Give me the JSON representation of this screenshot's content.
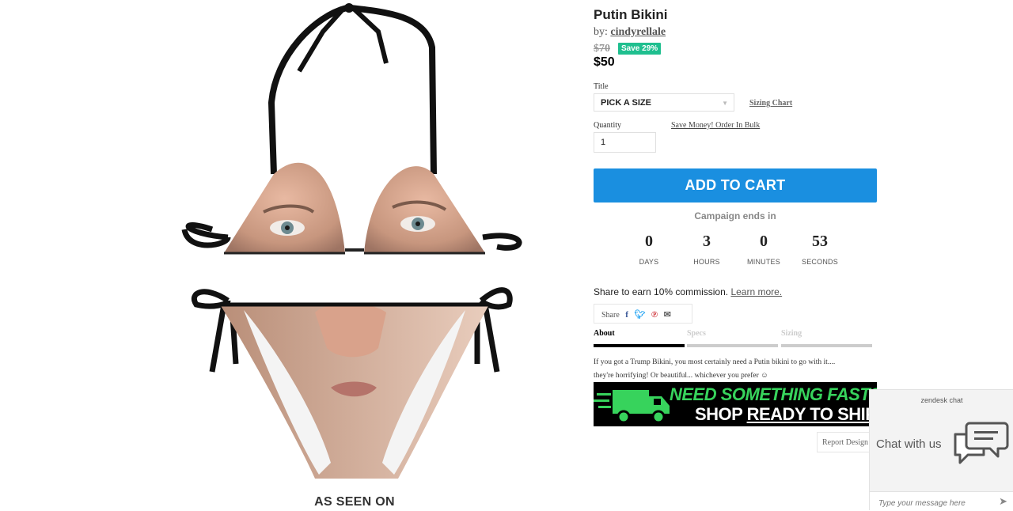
{
  "product": {
    "title": "Putin Bikini",
    "by_label": "by:",
    "creator": "cindyrellale",
    "old_price": "$70",
    "save_badge": "Save 29%",
    "price": "$50",
    "section_bottom": "AS SEEN ON"
  },
  "options": {
    "title_label": "Title",
    "size_value": "PICK A SIZE",
    "sizing_chart_link": "Sizing Chart",
    "quantity_label": "Quantity",
    "bulk_link": "Save Money! Order In Bulk",
    "quantity_value": "1"
  },
  "cart": {
    "button_label": "ADD TO CART"
  },
  "campaign": {
    "ends_label": "Campaign ends in",
    "countdown": [
      {
        "value": "0",
        "unit": "DAYS"
      },
      {
        "value": "3",
        "unit": "HOURS"
      },
      {
        "value": "0",
        "unit": "MINUTES"
      },
      {
        "value": "53",
        "unit": "SECONDS"
      }
    ]
  },
  "share": {
    "earn_text": "Share to earn 10% commission.",
    "learn_more": "Learn more.",
    "share_label": "Share",
    "icons": [
      "facebook-icon",
      "twitter-icon",
      "pinterest-icon",
      "email-icon"
    ]
  },
  "tabs": [
    {
      "label": "About",
      "active": true
    },
    {
      "label": "Specs",
      "active": false
    },
    {
      "label": "Sizing",
      "active": false
    }
  ],
  "about": {
    "line1": "If you got a Trump Bikini, you most certainly need a Putin bikini to go with it....",
    "line2": "they're horrifying! Or beautiful... whichever you prefer ☺"
  },
  "banner": {
    "line1": "NEED SOMETHING FAST?",
    "line2_a": "SHOP",
    "line2_b": "READY TO SHIP."
  },
  "report": {
    "label": "Report Design"
  },
  "chat": {
    "brand": "zendesk chat",
    "cta": "Chat with us",
    "placeholder": "Type your message here"
  },
  "colors": {
    "accent_blue": "#1a8fe0",
    "save_green": "#1fbf8f",
    "banner_green": "#37d35c",
    "tab_active": "#000000",
    "tab_inactive": "#cccccc"
  }
}
